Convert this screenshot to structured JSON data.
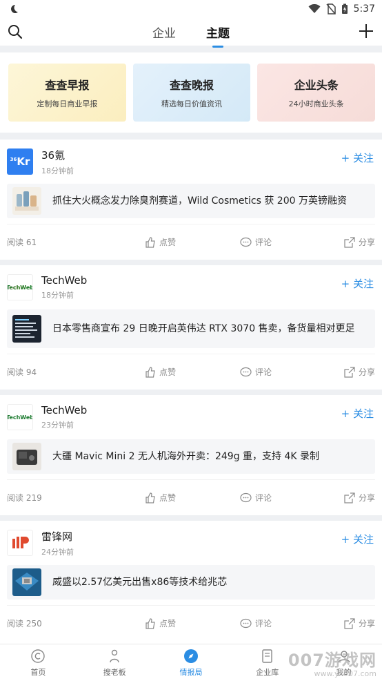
{
  "status": {
    "time": "5:37"
  },
  "topnav": {
    "tabs": [
      {
        "label": "企业"
      },
      {
        "label": "主题"
      }
    ]
  },
  "reports": [
    {
      "title": "查查早报",
      "subtitle": "定制每日商业早报"
    },
    {
      "title": "查查晚报",
      "subtitle": "精选每日价值资讯"
    },
    {
      "title": "企业头条",
      "subtitle": "24小时商业头条"
    }
  ],
  "feed": [
    {
      "source": "36氪",
      "logo_text": "Kr",
      "logo_sup": "36",
      "time": "18分钟前",
      "follow": "+ 关注",
      "title": "抓住大火概念发力除臭剂赛道，Wild Cosmetics 获 200 万英镑融资",
      "read": "阅读 61",
      "like": "点赞",
      "comment": "评论",
      "share": "分享"
    },
    {
      "source": "TechWeb",
      "logo_text": "TechWeb",
      "time": "18分钟前",
      "follow": "+ 关注",
      "title": "日本零售商宣布 29 日晚开启英伟达 RTX 3070 售卖，备货量相对更足",
      "read": "阅读 94",
      "like": "点赞",
      "comment": "评论",
      "share": "分享"
    },
    {
      "source": "TechWeb",
      "logo_text": "TechWeb",
      "time": "23分钟前",
      "follow": "+ 关注",
      "title": "大疆 Mavic Mini 2 无人机海外开卖：249g 重，支持 4K 录制",
      "read": "阅读 219",
      "like": "点赞",
      "comment": "评论",
      "share": "分享"
    },
    {
      "source": "雷锋网",
      "time": "24分钟前",
      "follow": "+ 关注",
      "title": "威盛以2.57亿美元出售x86等技术给兆芯",
      "read": "阅读 250",
      "like": "点赞",
      "comment": "评论",
      "share": "分享"
    }
  ],
  "bottom_nav": [
    {
      "label": "首页"
    },
    {
      "label": "搜老板"
    },
    {
      "label": "情报局"
    },
    {
      "label": "企业库"
    },
    {
      "label": "我的"
    }
  ],
  "watermark": {
    "big": "007游戏网",
    "small": "www.yx007.com"
  },
  "colors": {
    "accent": "#2b8de3",
    "logo_36kr": "#2f7ff0",
    "logo_leifeng": "#e04a2f"
  }
}
